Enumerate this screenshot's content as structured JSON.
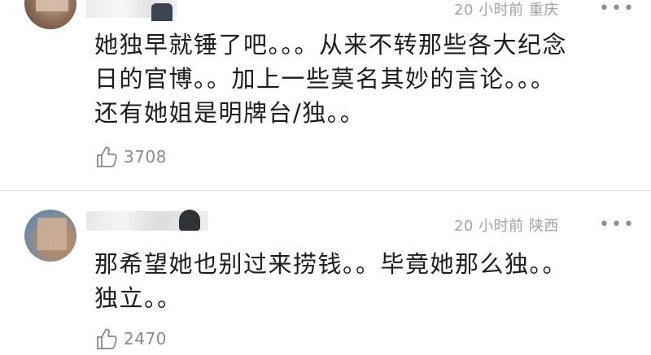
{
  "comments": [
    {
      "meta": "20 小时前  重庆",
      "more": "•••",
      "lines": [
        "她独早就锤了吧。。。从来不转那些各大纪念",
        "日的官博。。加上一些莫名其妙的言论。。。",
        "还有她姐是明牌台/独。。"
      ],
      "likes": "3708"
    },
    {
      "meta": "20 小时前  陕西",
      "more": "•••",
      "lines": [
        "那希望她也别过来捞钱。。毕竟她那么独。。",
        "独立。。"
      ],
      "likes": "2470"
    }
  ],
  "icons": {
    "more": "more-dots-icon",
    "like": "thumbs-up-icon"
  },
  "colors": {
    "text": "#1c1c1c",
    "meta": "#a3a3a3",
    "like_count": "#8a8a8a",
    "divider": "#e6e6e6"
  }
}
